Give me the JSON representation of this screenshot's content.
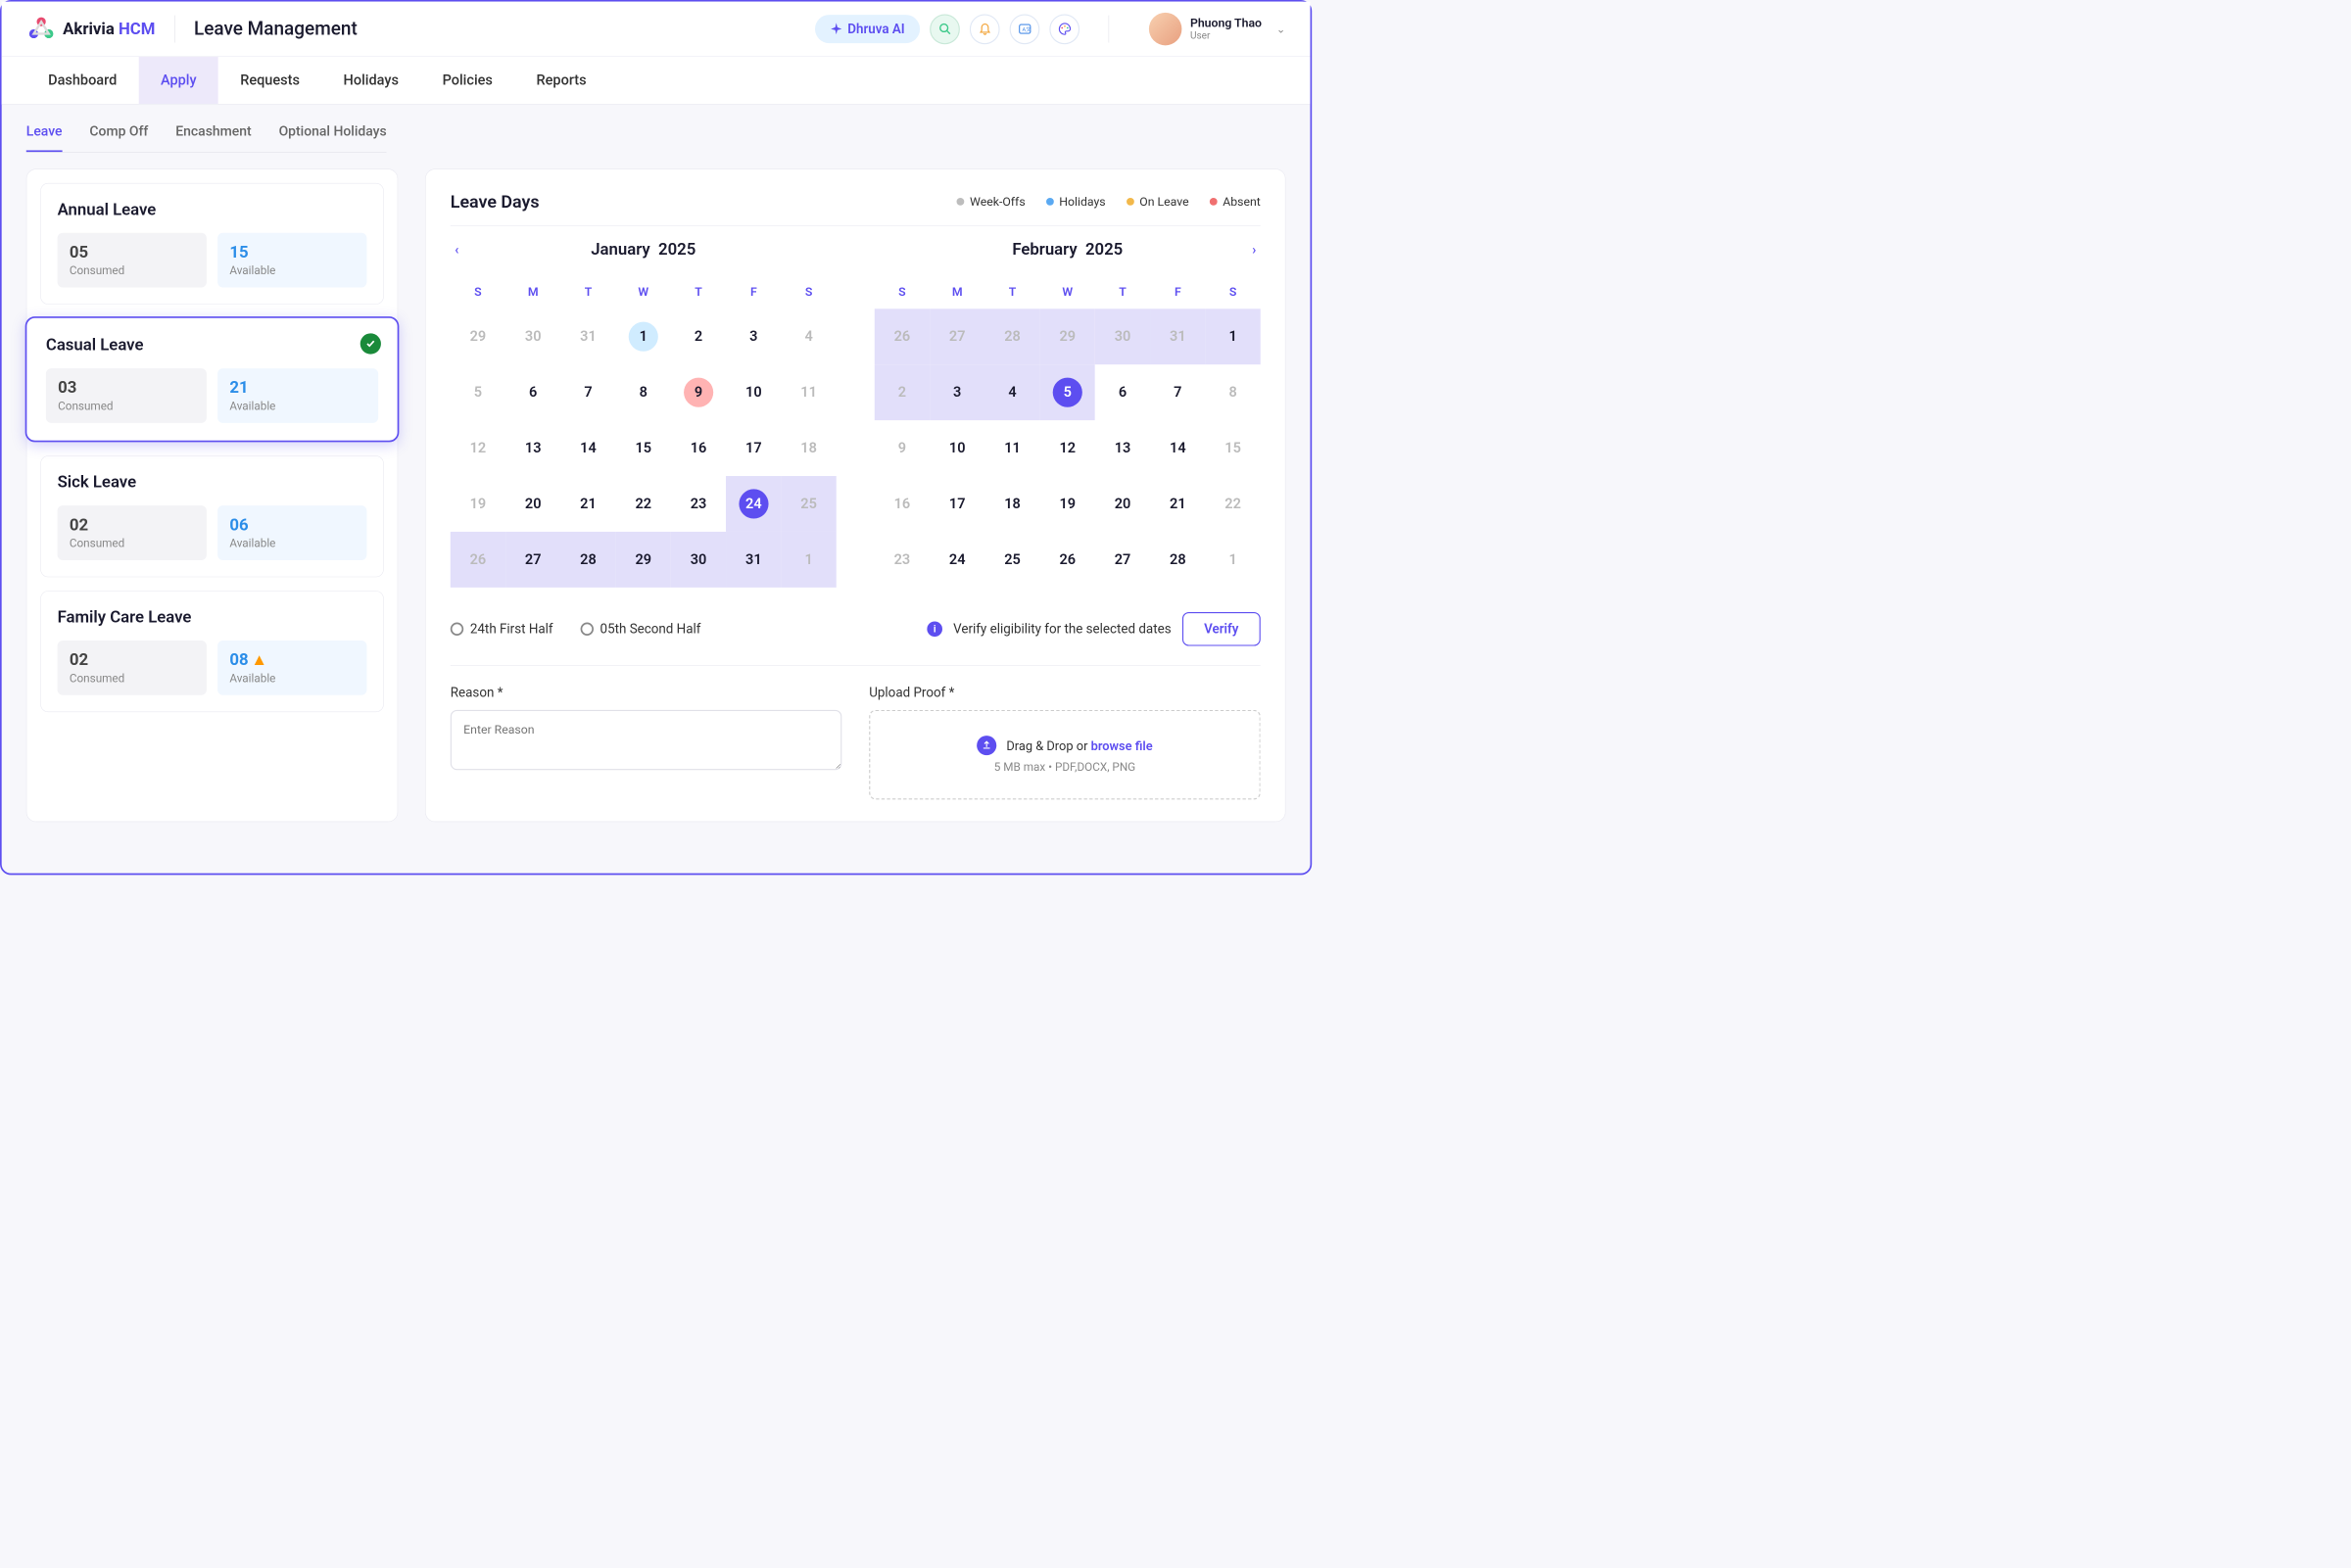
{
  "brand": {
    "name": "Akrivia",
    "suffix": "HCM"
  },
  "page_title": "Leave Management",
  "ai_button": "Dhruva AI",
  "user": {
    "name": "Phuong Thao",
    "role": "User"
  },
  "nav": [
    "Dashboard",
    "Apply",
    "Requests",
    "Holidays",
    "Policies",
    "Reports"
  ],
  "nav_active": 1,
  "subnav": [
    "Leave",
    "Comp Off",
    "Encashment",
    "Optional Holidays"
  ],
  "subnav_active": 0,
  "leave_types": [
    {
      "name": "Annual Leave",
      "consumed": "05",
      "available": "15",
      "selected": false,
      "warn": false
    },
    {
      "name": "Casual Leave",
      "consumed": "03",
      "available": "21",
      "selected": true,
      "warn": false
    },
    {
      "name": "Sick Leave",
      "consumed": "02",
      "available": "06",
      "selected": false,
      "warn": false
    },
    {
      "name": "Family Care Leave",
      "consumed": "02",
      "available": "08",
      "selected": false,
      "warn": true
    }
  ],
  "labels": {
    "consumed": "Consumed",
    "available": "Available"
  },
  "content_title": "Leave Days",
  "legend": [
    {
      "label": "Week-Offs",
      "color": "#bdbdbd"
    },
    {
      "label": "Holidays",
      "color": "#5aa9f2"
    },
    {
      "label": "On Leave",
      "color": "#f2b84a"
    },
    {
      "label": "Absent",
      "color": "#f07070"
    }
  ],
  "calendars": [
    {
      "month": "January",
      "year": "2025",
      "weekdays": [
        "S",
        "M",
        "T",
        "W",
        "T",
        "F",
        "S"
      ],
      "weeks": [
        [
          {
            "d": "29",
            "muted": true
          },
          {
            "d": "30",
            "muted": true
          },
          {
            "d": "31",
            "muted": true
          },
          {
            "d": "1",
            "today": true
          },
          {
            "d": "2"
          },
          {
            "d": "3"
          },
          {
            "d": "4",
            "muted": true
          }
        ],
        [
          {
            "d": "5",
            "muted": true
          },
          {
            "d": "6"
          },
          {
            "d": "7"
          },
          {
            "d": "8"
          },
          {
            "d": "9",
            "absent": true
          },
          {
            "d": "10"
          },
          {
            "d": "11",
            "muted": true
          }
        ],
        [
          {
            "d": "12",
            "muted": true
          },
          {
            "d": "13"
          },
          {
            "d": "14"
          },
          {
            "d": "15"
          },
          {
            "d": "16"
          },
          {
            "d": "17"
          },
          {
            "d": "18",
            "muted": true
          }
        ],
        [
          {
            "d": "19",
            "muted": true
          },
          {
            "d": "20"
          },
          {
            "d": "21"
          },
          {
            "d": "22"
          },
          {
            "d": "23"
          },
          {
            "d": "24",
            "selected": true,
            "range": true
          },
          {
            "d": "25",
            "muted": true,
            "range": true
          }
        ],
        [
          {
            "d": "26",
            "muted": true,
            "range": true
          },
          {
            "d": "27",
            "range": true
          },
          {
            "d": "28",
            "range": true
          },
          {
            "d": "29",
            "range": true
          },
          {
            "d": "30",
            "range": true
          },
          {
            "d": "31",
            "range": true
          },
          {
            "d": "1",
            "muted": true,
            "range": true
          }
        ]
      ]
    },
    {
      "month": "February",
      "year": "2025",
      "weekdays": [
        "S",
        "M",
        "T",
        "W",
        "T",
        "F",
        "S"
      ],
      "weeks": [
        [
          {
            "d": "26",
            "muted": true,
            "range": true
          },
          {
            "d": "27",
            "muted": true,
            "range": true
          },
          {
            "d": "28",
            "muted": true,
            "range": true
          },
          {
            "d": "29",
            "muted": true,
            "range": true
          },
          {
            "d": "30",
            "muted": true,
            "range": true
          },
          {
            "d": "31",
            "muted": true,
            "range": true
          },
          {
            "d": "1",
            "range": true
          }
        ],
        [
          {
            "d": "2",
            "muted": true,
            "range": true
          },
          {
            "d": "3",
            "range": true
          },
          {
            "d": "4",
            "range": true
          },
          {
            "d": "5",
            "selected": true,
            "range": true
          },
          {
            "d": "6"
          },
          {
            "d": "7"
          },
          {
            "d": "8",
            "muted": true
          }
        ],
        [
          {
            "d": "9",
            "muted": true
          },
          {
            "d": "10"
          },
          {
            "d": "11"
          },
          {
            "d": "12"
          },
          {
            "d": "13"
          },
          {
            "d": "14"
          },
          {
            "d": "15",
            "muted": true
          }
        ],
        [
          {
            "d": "16",
            "muted": true
          },
          {
            "d": "17"
          },
          {
            "d": "18"
          },
          {
            "d": "19"
          },
          {
            "d": "20"
          },
          {
            "d": "21"
          },
          {
            "d": "22",
            "muted": true
          }
        ],
        [
          {
            "d": "23",
            "muted": true
          },
          {
            "d": "24"
          },
          {
            "d": "25"
          },
          {
            "d": "26"
          },
          {
            "d": "27"
          },
          {
            "d": "28"
          },
          {
            "d": "1",
            "muted": true
          }
        ]
      ]
    }
  ],
  "half_options": [
    "24th First Half",
    "05th Second Half"
  ],
  "verify_text": "Verify eligibility for the selected dates",
  "verify_button": "Verify",
  "reason": {
    "label": "Reason",
    "placeholder": "Enter Reason"
  },
  "upload": {
    "label": "Upload Proof",
    "drag_text": "Drag & Drop or",
    "browse_text": "browse file",
    "hint": "5 MB max • PDF,DOCX, PNG"
  }
}
